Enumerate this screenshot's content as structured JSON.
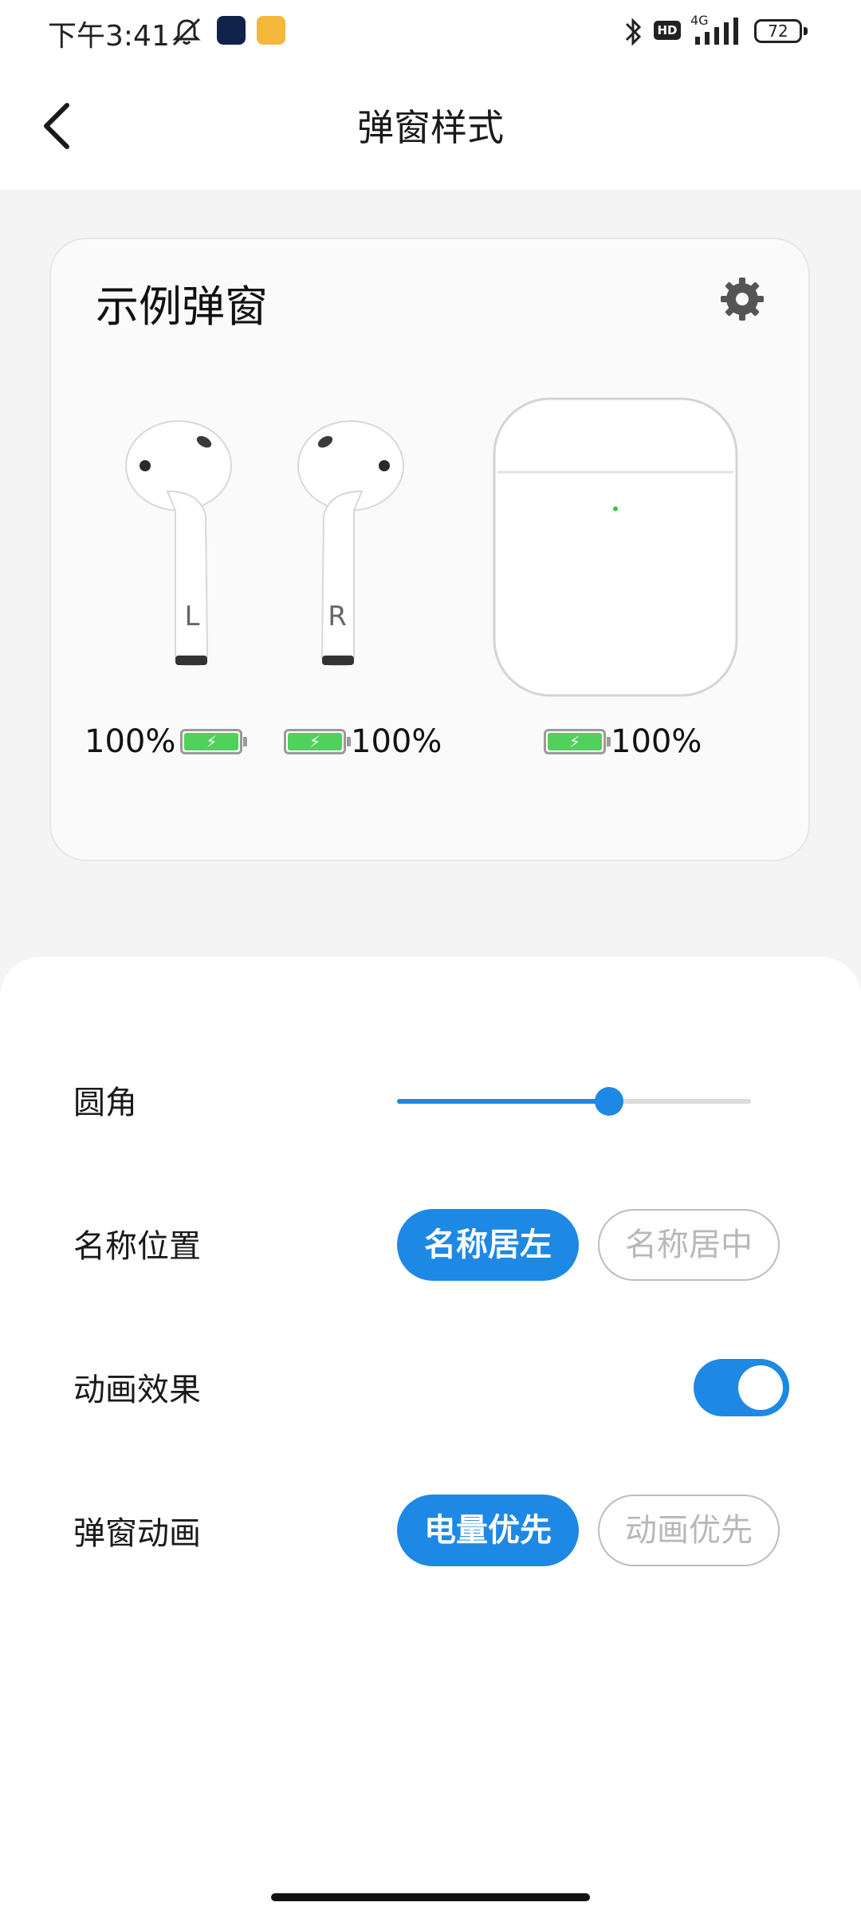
{
  "status_bar": {
    "time": "下午3:41",
    "network": "4G",
    "hd_label": "HD",
    "battery": "72",
    "icons": [
      "silent-icon",
      "app-icon-security",
      "app-icon-messages",
      "bluetooth-icon",
      "hd-icon",
      "signal-icon",
      "battery-icon"
    ]
  },
  "header": {
    "title": "弹窗样式",
    "back_icon": "chevron-left-icon"
  },
  "preview": {
    "title": "示例弹窗",
    "settings_icon": "gear-icon",
    "left_bud": {
      "letter": "L",
      "battery": "100%",
      "level": 1.0
    },
    "right_bud": {
      "letter": "R",
      "battery": "100%",
      "level": 1.0
    },
    "case": {
      "battery": "100%",
      "level": 1.0
    },
    "colors": {
      "battery_green": "#4fd15c",
      "case_led": "#2ecc40"
    }
  },
  "settings": {
    "corner": {
      "label": "圆角",
      "value_fraction": 0.6
    },
    "name_position": {
      "label": "名称位置",
      "options": [
        "名称居左",
        "名称居中"
      ],
      "selected": "名称居左"
    },
    "animation_effect": {
      "label": "动画效果",
      "enabled": true
    },
    "popup_animation": {
      "label": "弹窗动画",
      "options": [
        "电量优先",
        "动画优先"
      ],
      "selected": "电量优先"
    }
  },
  "colors": {
    "accent": "#1e88e5",
    "background": "#f4f4f4"
  }
}
